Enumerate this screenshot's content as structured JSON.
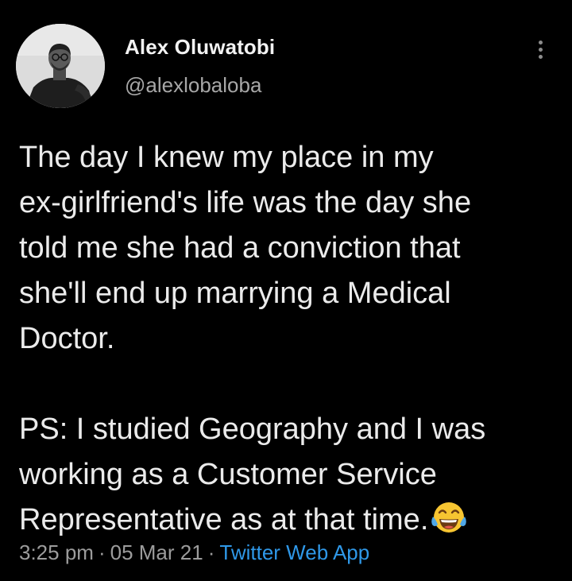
{
  "user": {
    "display_name": "Alex Oluwatobi",
    "handle": "@alexlobaloba"
  },
  "tweet": {
    "paragraph_1": [
      "The day I knew my place in my",
      "ex-girlfriend's life was the day she",
      "told me she had a conviction that",
      "she'll end up marrying a Medical",
      "Doctor."
    ],
    "paragraph_2": [
      "PS: I studied Geography and I was",
      "working as a Customer Service",
      "Representative as at that time."
    ],
    "emoji": "face-with-tears-of-joy-icon"
  },
  "meta": {
    "time": "3:25 pm",
    "separator": "·",
    "date": "05 Mar 21",
    "source": "Twitter Web App"
  },
  "colors": {
    "background": "#000000",
    "text": "#ebebeb",
    "secondary_text": "#9c9c9c",
    "link": "#2f98e8"
  },
  "icons": {
    "more": "more-vertical-icon",
    "avatar": "avatar"
  }
}
